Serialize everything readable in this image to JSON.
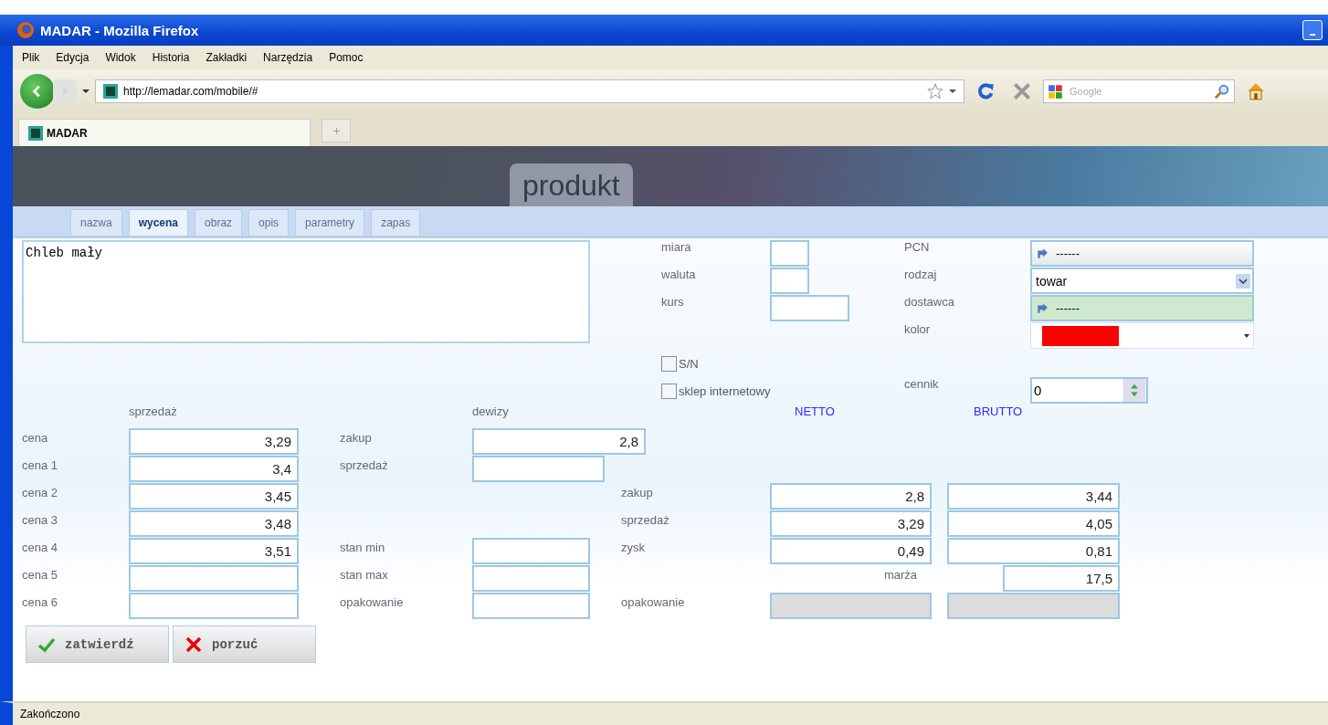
{
  "window": {
    "title": "MADAR - Mozilla Firefox"
  },
  "menu": [
    "Plik",
    "Edycja",
    "Widok",
    "Historia",
    "Zakładki",
    "Narzędzia",
    "Pomoc"
  ],
  "address": {
    "url": "http://lemadar.com/mobile/#"
  },
  "search": {
    "placeholder": "Google"
  },
  "browser_tabs": [
    {
      "label": "MADAR",
      "selected": true
    }
  ],
  "page": {
    "heading": "produkt",
    "tabs": [
      {
        "label": "nazwa",
        "selected": false
      },
      {
        "label": "wycena",
        "selected": true
      },
      {
        "label": "obraz",
        "selected": false
      },
      {
        "label": "opis",
        "selected": false
      },
      {
        "label": "parametry",
        "selected": false
      },
      {
        "label": "zapas",
        "selected": false
      }
    ],
    "description": "Chleb mały",
    "miara": {
      "label": "miara"
    },
    "waluta": {
      "label": "waluta"
    },
    "kurs": {
      "label": "kurs"
    },
    "pcn": {
      "label": "PCN",
      "value": "------"
    },
    "rodzaj": {
      "label": "rodzaj",
      "value": "towar"
    },
    "dostawca": {
      "label": "dostawca",
      "value": "------"
    },
    "kolor": {
      "label": "kolor",
      "color": "#ff0000"
    },
    "checkboxes": [
      {
        "label": "S/N",
        "checked": false
      },
      {
        "label": "sklep internetowy",
        "checked": false
      }
    ],
    "cennik": {
      "label": "cennik",
      "value": "0"
    },
    "prices": {
      "header": "sprzedaż",
      "rows": [
        {
          "label": "cena",
          "value": "3,29"
        },
        {
          "label": "cena 1",
          "value": "3,4"
        },
        {
          "label": "cena 2",
          "value": "3,45"
        },
        {
          "label": "cena 3",
          "value": "3,48"
        },
        {
          "label": "cena 4",
          "value": "3,51"
        },
        {
          "label": "cena 5"
        },
        {
          "label": "cena 6"
        }
      ]
    },
    "dewizy": {
      "header": "dewizy",
      "fields": [
        {
          "label": "zakup",
          "value": "2,8"
        },
        {
          "label": "sprzedaż"
        }
      ]
    },
    "stock": [
      {
        "label": "stan min"
      },
      {
        "label": "stan max"
      },
      {
        "label": "opakowanie"
      }
    ],
    "totals": {
      "netto_header": "NETTO",
      "brutto_header": "BRUTTO",
      "rows": [
        {
          "label": "zakup",
          "netto": "2,8",
          "brutto": "3,44"
        },
        {
          "label": "sprzedaż",
          "netto": "3,29",
          "brutto": "4,05"
        },
        {
          "label": "zysk",
          "netto": "0,49",
          "brutto": "0,81"
        }
      ],
      "margin": {
        "label": "marża",
        "value": "17,5"
      },
      "packaging": {
        "label": "opakowanie",
        "disabled": true
      }
    },
    "buttons": [
      {
        "label": "zatwierdź",
        "kind": "confirm"
      },
      {
        "label": "porzuć",
        "kind": "cancel"
      }
    ]
  },
  "status_bar": "Zakończono"
}
